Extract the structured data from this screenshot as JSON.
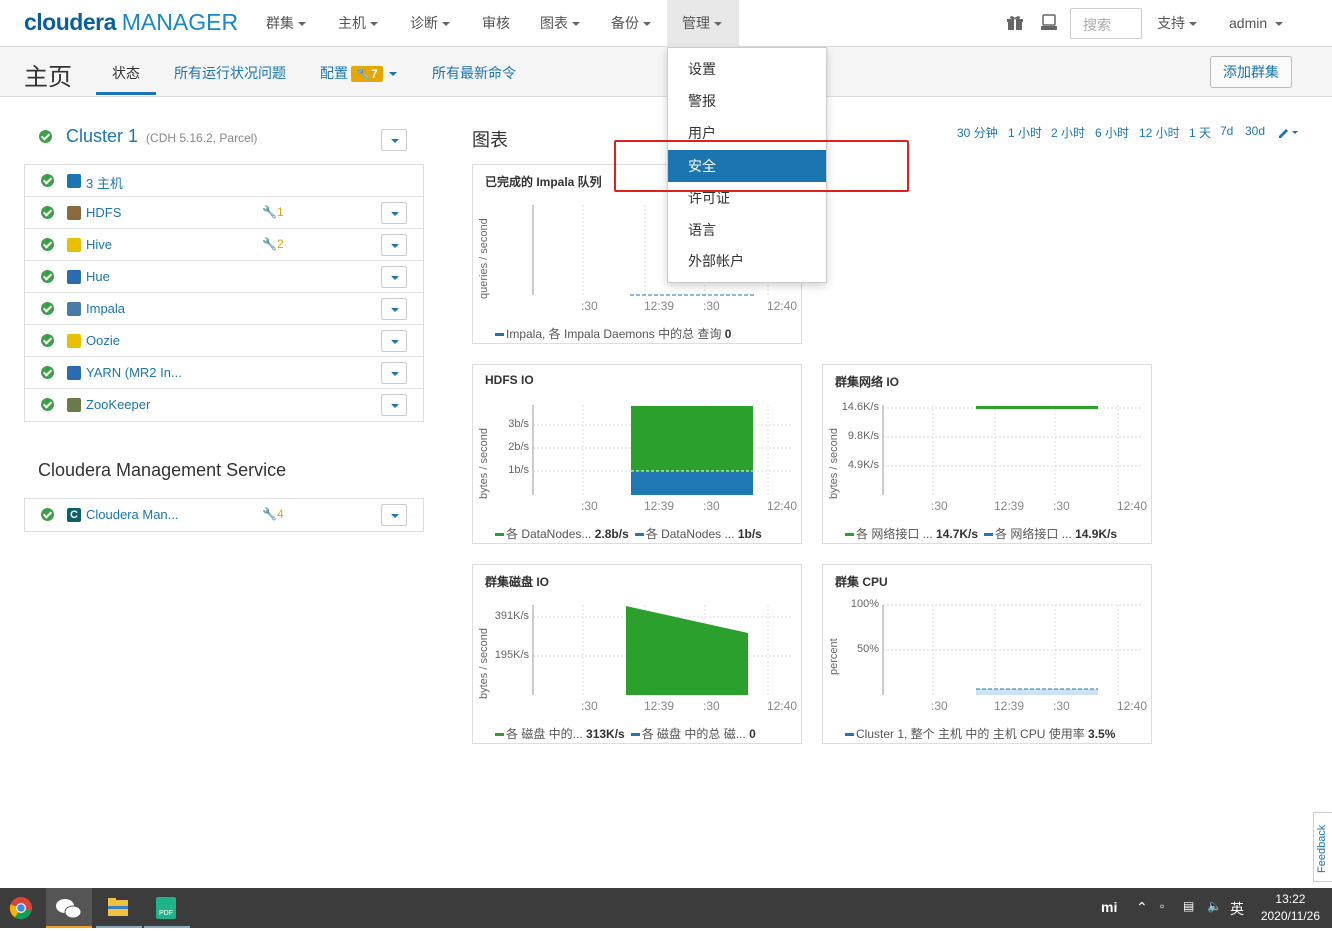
{
  "topnav": {
    "logo_brand": "cloudera",
    "logo_product": "MANAGER",
    "items": [
      "群集",
      "主机",
      "诊断",
      "审核",
      "图表",
      "备份",
      "管理"
    ],
    "search_placeholder": "搜索",
    "support": "支持",
    "user": "admin"
  },
  "subnav": {
    "title": "主页",
    "tabs": [
      "状态",
      "所有运行状况问题",
      "配置",
      "所有最新命令"
    ],
    "config_badge": "7",
    "add_cluster": "添加群集"
  },
  "cluster": {
    "name": "Cluster 1",
    "version": "(CDH 5.16.2, Parcel)",
    "services": [
      {
        "name": "3 主机",
        "icon": "hosts-list-icon",
        "color": "#1b75b0",
        "issues": ""
      },
      {
        "name": "HDFS",
        "icon": "hdfs-icon",
        "color": "#8a6a3a",
        "issues": "1"
      },
      {
        "name": "Hive",
        "icon": "hive-icon",
        "color": "#e8c000",
        "issues": "2"
      },
      {
        "name": "Hue",
        "icon": "hue-icon",
        "color": "#2b6cb0",
        "issues": ""
      },
      {
        "name": "Impala",
        "icon": "impala-icon",
        "color": "#4a7aa8",
        "issues": ""
      },
      {
        "name": "Oozie",
        "icon": "oozie-icon",
        "color": "#e8c000",
        "issues": ""
      },
      {
        "name": "YARN (MR2 In...",
        "icon": "yarn-icon",
        "color": "#2b6cb0",
        "issues": ""
      },
      {
        "name": "ZooKeeper",
        "icon": "zookeeper-icon",
        "color": "#6a7a4a",
        "issues": ""
      }
    ]
  },
  "management": {
    "title": "Cloudera Management Service",
    "service": {
      "name": "Cloudera Man...",
      "icon": "cloudera-icon",
      "issues": "4"
    }
  },
  "charts_section": {
    "title": "图表",
    "time_ranges": [
      "30 分钟",
      "1 小时",
      "2 小时",
      "6 小时",
      "12 小时",
      "1 天",
      "7d",
      "30d"
    ]
  },
  "admin_menu": {
    "items": [
      "设置",
      "警报",
      "用户",
      "安全",
      "许可证",
      "语言",
      "外部帐户"
    ],
    "highlighted": "安全"
  },
  "charts": [
    {
      "title": "已完成的 Impala 队列",
      "ylabel": "queries / second",
      "xticks": [
        ":30",
        "12:39",
        ":30",
        "12:40"
      ],
      "yticks": [],
      "legend": [
        {
          "label": "Impala, 各 Impala Daemons 中的总 查询",
          "value": "0",
          "color": "#1b75b0"
        }
      ]
    },
    {
      "title": "HDFS IO",
      "ylabel": "bytes / second",
      "xticks": [
        ":30",
        "12:39",
        ":30",
        "12:40"
      ],
      "yticks": [
        "3b/s",
        "2b/s",
        "1b/s"
      ],
      "legend": [
        {
          "label": "各 DataNodes...",
          "value": "2.8b/s",
          "color": "#2ca02c"
        },
        {
          "label": "各 DataNodes ...",
          "value": "1b/s",
          "color": "#1f77b4"
        }
      ]
    },
    {
      "title": "群集网络 IO",
      "ylabel": "bytes / second",
      "xticks": [
        ":30",
        "12:39",
        ":30",
        "12:40"
      ],
      "yticks": [
        "14.6K/s",
        "9.8K/s",
        "4.9K/s"
      ],
      "legend": [
        {
          "label": "各 网络接口 ...",
          "value": "14.7K/s",
          "color": "#2ca02c"
        },
        {
          "label": "各 网络接口 ...",
          "value": "14.9K/s",
          "color": "#1f77b4"
        }
      ]
    },
    {
      "title": "群集磁盘 IO",
      "ylabel": "bytes / second",
      "xticks": [
        ":30",
        "12:39",
        ":30",
        "12:40"
      ],
      "yticks": [
        "391K/s",
        "195K/s"
      ],
      "legend": [
        {
          "label": "各 磁盘 中的...",
          "value": "313K/s",
          "color": "#2ca02c"
        },
        {
          "label": "各 磁盘 中的总 磁...",
          "value": "0",
          "color": "#1f77b4"
        }
      ]
    },
    {
      "title": "群集 CPU",
      "ylabel": "percent",
      "xticks": [
        ":30",
        "12:39",
        ":30",
        "12:40"
      ],
      "yticks": [
        "100%",
        "50%"
      ],
      "legend": [
        {
          "label": "Cluster 1, 整个 主机 中的 主机 CPU 使用率",
          "value": "3.5%",
          "color": "#1f77b4"
        }
      ]
    }
  ],
  "feedback": "Feedback",
  "taskbar": {
    "time": "13:22",
    "date": "2020/11/26",
    "ime": "英"
  }
}
